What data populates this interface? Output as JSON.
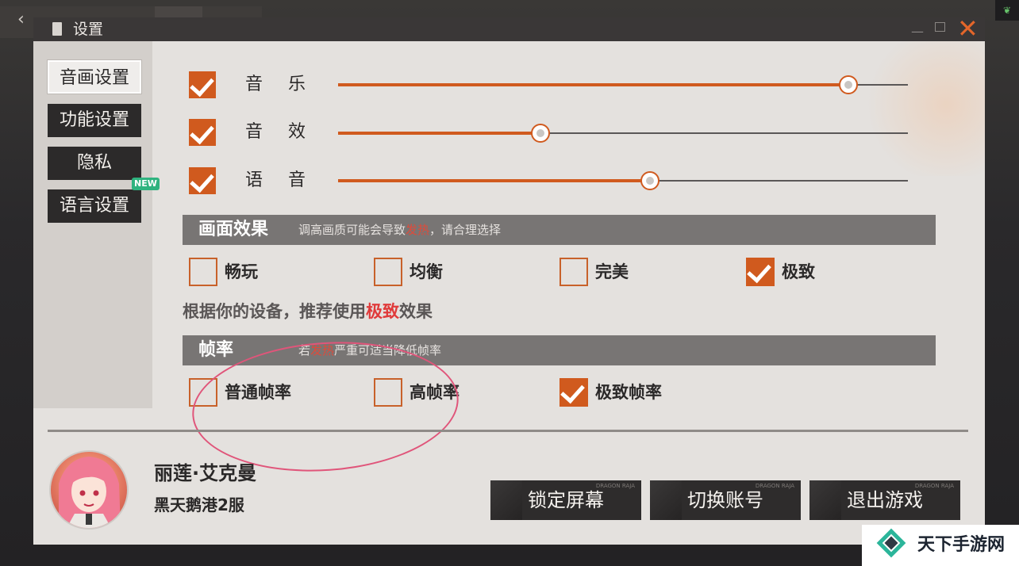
{
  "window": {
    "title": "设置",
    "close_icon": "✕"
  },
  "sidebar": {
    "items": [
      {
        "label": "音画设置",
        "active": true
      },
      {
        "label": "功能设置",
        "active": false
      },
      {
        "label": "隐私",
        "active": false
      },
      {
        "label": "语言设置",
        "active": false
      }
    ],
    "new_badge": "NEW"
  },
  "volume": {
    "music": {
      "label": "音乐",
      "checked": true,
      "level": 0.895
    },
    "sfx": {
      "label": "音效",
      "checked": true,
      "level": 0.355
    },
    "voice": {
      "label": "语音",
      "checked": true,
      "level": 0.548
    }
  },
  "graphics": {
    "title": "画面效果",
    "hint_before": "调高画质可能会导致",
    "hint_highlight": "发热",
    "hint_after": "，请合理选择",
    "options": [
      {
        "label": "畅玩",
        "checked": false
      },
      {
        "label": "均衡",
        "checked": false
      },
      {
        "label": "完美",
        "checked": false
      },
      {
        "label": "极致",
        "checked": true
      }
    ],
    "recommend_before": "根据你的设备，推荐使用",
    "recommend_highlight": "极致",
    "recommend_after": "效果"
  },
  "framerate": {
    "title": "帧率",
    "hint_before": "若",
    "hint_highlight": "发热",
    "hint_after": "严重可适当降低帧率",
    "options": [
      {
        "label": "普通帧率",
        "checked": false
      },
      {
        "label": "高帧率",
        "checked": false
      },
      {
        "label": "极致帧率",
        "checked": true
      }
    ]
  },
  "player": {
    "name": "丽莲·艾克曼",
    "server": "黑天鹅港2服"
  },
  "actions": {
    "lock_screen": "锁定屏幕",
    "switch_account": "切换账号",
    "exit_game": "退出游戏",
    "watermark": "DRAGON RAJA"
  },
  "site_logo": {
    "text": "天下手游网"
  },
  "colors": {
    "accent": "#d05a1e",
    "highlight": "#e04a3a",
    "badge": "#2fb37f"
  }
}
